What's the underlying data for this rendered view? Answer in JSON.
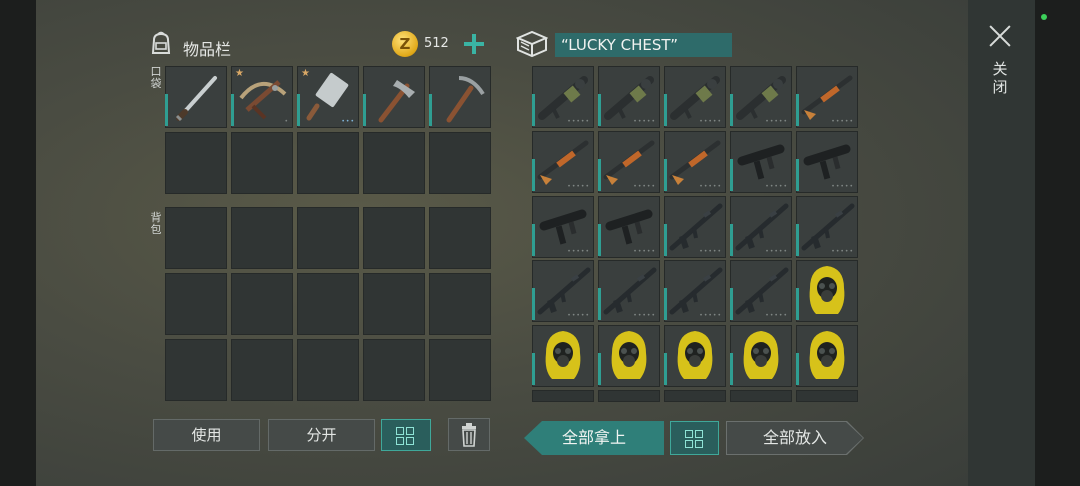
{
  "inventory": {
    "title": "物品栏",
    "coins": "512",
    "pocket_label": "口袋",
    "backpack_label": "背包",
    "pockets": [
      {
        "name": "machete",
        "icon": "machete-icon",
        "dots": ""
      },
      {
        "name": "crossbow",
        "icon": "crossbow-icon",
        "dots": "•",
        "badge": "★"
      },
      {
        "name": "cleaver",
        "icon": "cleaver-icon",
        "dots": "•••",
        "badge": "★"
      },
      {
        "name": "hatchet",
        "icon": "hatchet-icon",
        "dots": ""
      },
      {
        "name": "pickaxe",
        "icon": "pickaxe-icon",
        "dots": ""
      }
    ]
  },
  "chest": {
    "title": "“LUCKY CHEST”",
    "items": [
      "launcher",
      "launcher",
      "launcher",
      "launcher",
      "shotgun",
      "shotgun",
      "shotgun",
      "shotgun",
      "smg",
      "smg",
      "smg",
      "smg",
      "rifle",
      "rifle",
      "rifle",
      "rifle",
      "rifle",
      "rifle",
      "rifle",
      "hazmat",
      "hazmat",
      "hazmat",
      "hazmat",
      "hazmat",
      "hazmat"
    ]
  },
  "buttons": {
    "use": "使用",
    "split": "分开",
    "take_all": "全部拿上",
    "put_all": "全部放入",
    "close": "关闭"
  },
  "colors": {
    "accent": "#2f9e92",
    "chest_title_bg": "#2e6b6a"
  }
}
